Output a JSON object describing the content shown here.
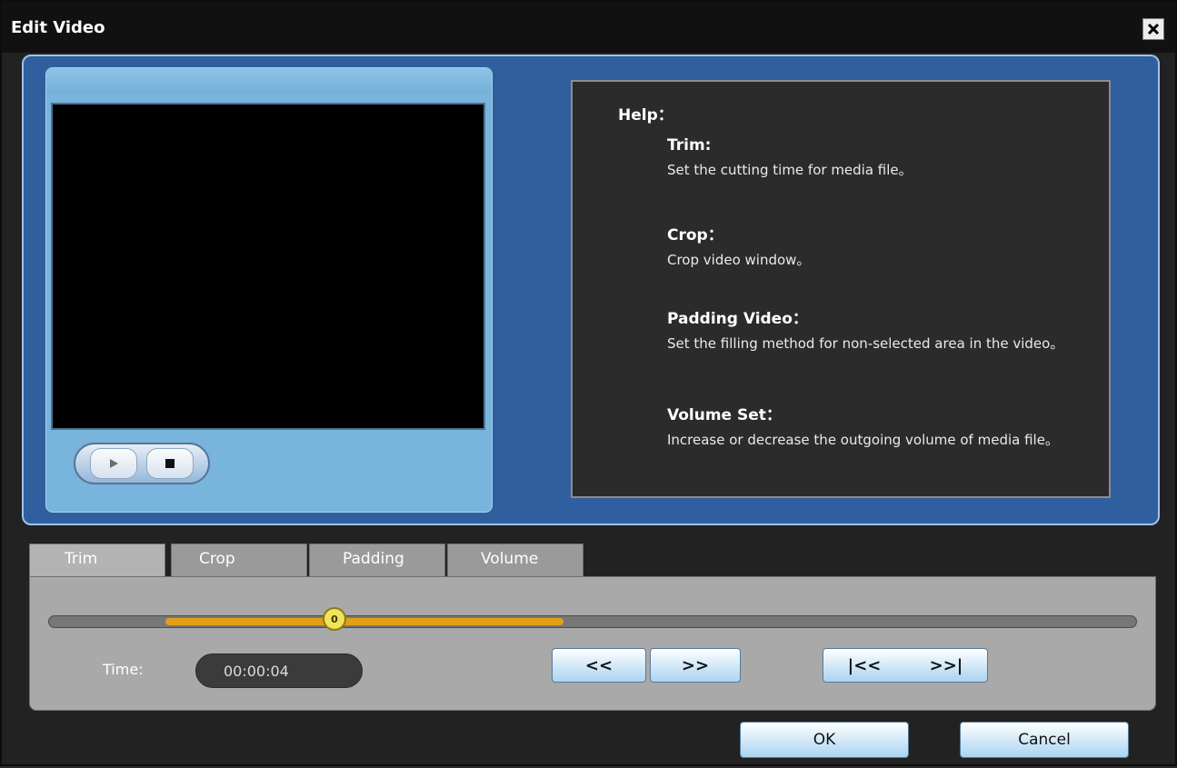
{
  "window": {
    "title": "Edit Video"
  },
  "help": {
    "title": "Help：",
    "items": [
      {
        "title": "Trim:",
        "desc": "Set the cutting time for media file。"
      },
      {
        "title": "Crop：",
        "desc": "Crop video window。"
      },
      {
        "title": "Padding Video：",
        "desc": "Set the filling method for non-selected area in the video。"
      },
      {
        "title": "Volume Set：",
        "desc": "Increase or decrease the outgoing volume of media file。"
      }
    ]
  },
  "tabs": [
    {
      "label": "Trim",
      "active": true
    },
    {
      "label": "Crop",
      "active": false
    },
    {
      "label": "Padding",
      "active": false
    },
    {
      "label": "Volume",
      "active": false
    }
  ],
  "trim": {
    "slider_knob_label": "0",
    "time_label": "Time:",
    "time_value": "00:00:04",
    "rewind_label": "<<",
    "forward_label": ">>",
    "set_start_label": "|<<",
    "set_end_label": ">>|"
  },
  "buttons": {
    "ok": "OK",
    "cancel": "Cancel"
  },
  "colors": {
    "panel_blue": "#2f5f9e",
    "slider_fill": "#e3a017",
    "button_gradient_bottom": "#a9d4f1"
  }
}
